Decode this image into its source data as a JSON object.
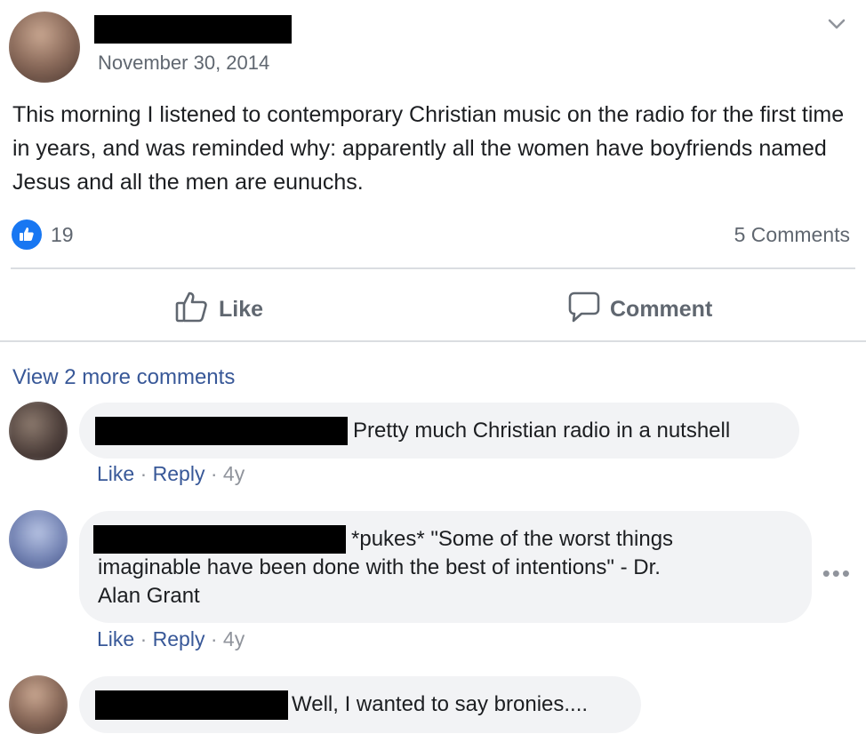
{
  "post": {
    "date": "November 30, 2014",
    "text": "This morning I listened to contemporary Christian music on the radio for the first time in years, and was reminded why: apparently all the women have boyfriends named Jesus and all the men are eunuchs.",
    "like_count": "19",
    "comments_count": "5 Comments"
  },
  "actions": {
    "like_label": "Like",
    "comment_label": "Comment"
  },
  "comments_section": {
    "view_more": "View 2 more comments",
    "comments": [
      {
        "text": "Pretty much Christian radio in a nutshell",
        "like": "Like",
        "reply": "Reply",
        "age": "4y"
      },
      {
        "text_line1": "*pukes* \"Some of the worst things",
        "text_line2": "imaginable have been done with the best of intentions\" - Dr.",
        "text_line3": "Alan Grant",
        "like": "Like",
        "reply": "Reply",
        "age": "4y"
      },
      {
        "text": "Well, I wanted to say bronies...."
      }
    ]
  },
  "icons": {
    "options": "chevron-down-icon",
    "like_badge": "thumbs-up-icon",
    "like_action": "thumbs-up-outline-icon",
    "comment_action": "speech-bubble-icon",
    "more": "more-options-icon"
  },
  "colors": {
    "link": "#385898",
    "like_blue": "#1877f2",
    "muted": "#606770",
    "bubble": "#f2f3f5"
  }
}
